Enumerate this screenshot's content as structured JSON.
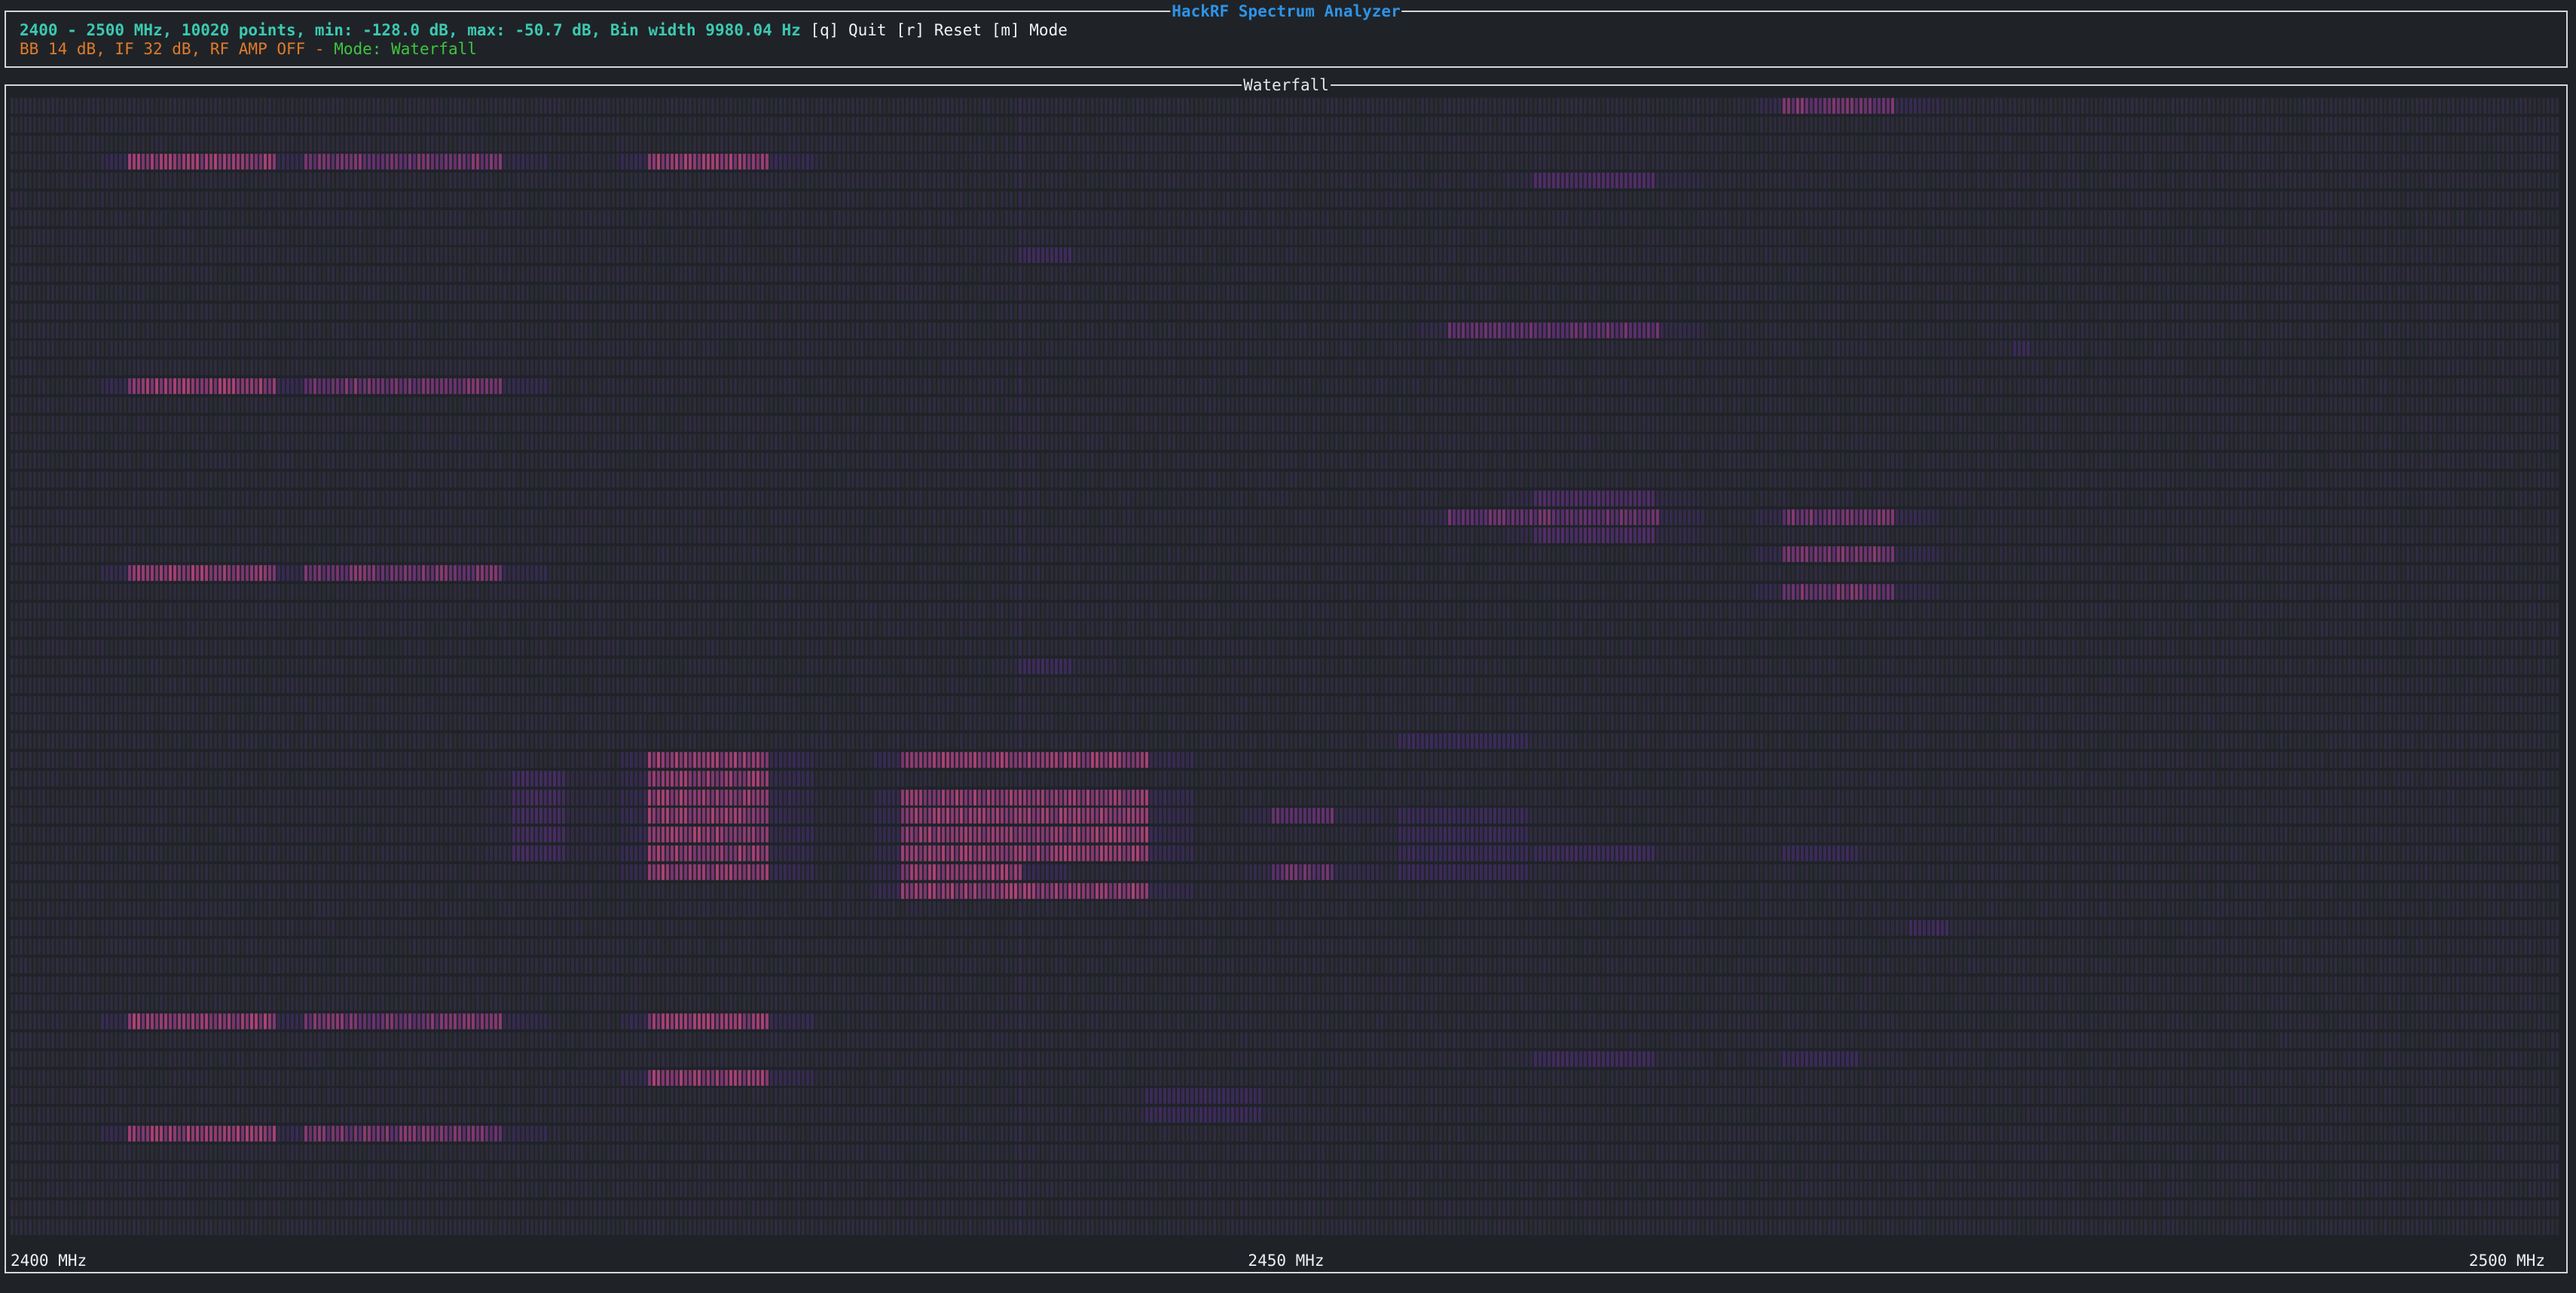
{
  "header": {
    "title": "HackRF Spectrum Analyzer",
    "info_line": "2400 - 2500 MHz, 10020 points, min: -128.0 dB, max: -50.7 dB, Bin width 9980.04 Hz",
    "keys": [
      {
        "key": "[q]",
        "label": "Quit"
      },
      {
        "key": "[r]",
        "label": "Reset"
      },
      {
        "key": "[m]",
        "label": "Mode"
      }
    ],
    "gain_line": "BB 14 dB, IF 32 dB, RF AMP OFF - ",
    "mode_line": "Mode: Waterfall"
  },
  "waterfall": {
    "title": "Waterfall",
    "freq_start_label": "2400 MHz",
    "freq_mid_label": "2450 MHz",
    "freq_end_label": "2500 MHz",
    "freq_start_mhz": 2400,
    "freq_end_mhz": 2500,
    "colors": {
      "background": "#1f2328",
      "cell_low": "#2b2c33",
      "cell_mid": "#3a2b58",
      "cell_purple": "#5a2f6e",
      "cell_high": "#c4477a",
      "header_title": "#2e93e6",
      "info_text": "#3cc9b0",
      "gain_text": "#e07b2a",
      "mode_text": "#3fc43f"
    },
    "signals": [
      {
        "f0": 2404.6,
        "f1": 2410.5,
        "rows": [
          3,
          15,
          25,
          49,
          55
        ],
        "level": 0.85
      },
      {
        "f0": 2411.6,
        "f1": 2419.4,
        "rows": [
          3,
          15,
          25,
          49,
          55
        ],
        "level": 0.75
      },
      {
        "f0": 2409.6,
        "f1": 2412.0,
        "rows": [
          61
        ],
        "level": 0.7
      },
      {
        "f0": 2425.0,
        "f1": 2429.7,
        "rows": [
          3,
          35,
          36,
          37,
          38,
          39,
          40,
          41,
          49,
          52,
          61
        ],
        "level": 0.85
      },
      {
        "f0": 2434.9,
        "f1": 2444.7,
        "rows": [
          35,
          37,
          38,
          39,
          40,
          42
        ],
        "level": 0.85
      },
      {
        "f0": 2434.9,
        "f1": 2439.7,
        "rows": [
          41
        ],
        "level": 0.85
      },
      {
        "f0": 2459.8,
        "f1": 2464.5,
        "rows": [
          4,
          21,
          22,
          23
        ],
        "level": 0.55
      },
      {
        "f0": 2456.3,
        "f1": 2464.8,
        "rows": [
          12,
          22
        ],
        "level": 0.7
      },
      {
        "f0": 2469.5,
        "f1": 2474.0,
        "rows": [
          0,
          22,
          24,
          26
        ],
        "level": 0.75
      },
      {
        "f0": 2449.4,
        "f1": 2452.0,
        "rows": [
          38,
          41
        ],
        "level": 0.7
      },
      {
        "f0": 2419.6,
        "f1": 2421.8,
        "rows": [
          36,
          37,
          38,
          39,
          40
        ],
        "level": 0.45
      },
      {
        "f0": 2444.5,
        "f1": 2449.2,
        "rows": [
          54,
          53
        ],
        "level": 0.35
      },
      {
        "f0": 2459.8,
        "f1": 2464.5,
        "rows": [
          40,
          51
        ],
        "level": 0.4
      },
      {
        "f0": 2469.5,
        "f1": 2472.5,
        "rows": [
          40,
          51
        ],
        "level": 0.35
      },
      {
        "f0": 2439.5,
        "f1": 2441.7,
        "rows": [
          8,
          30
        ],
        "level": 0.4
      },
      {
        "f0": 2454.5,
        "f1": 2459.5,
        "rows": [
          34,
          38,
          39,
          40,
          41
        ],
        "level": 0.35
      },
      {
        "f0": 2474.5,
        "f1": 2476.0,
        "rows": [
          44
        ],
        "level": 0.4
      },
      {
        "f0": 2478.5,
        "f1": 2479.2,
        "rows": [
          13
        ],
        "level": 0.35
      }
    ]
  }
}
